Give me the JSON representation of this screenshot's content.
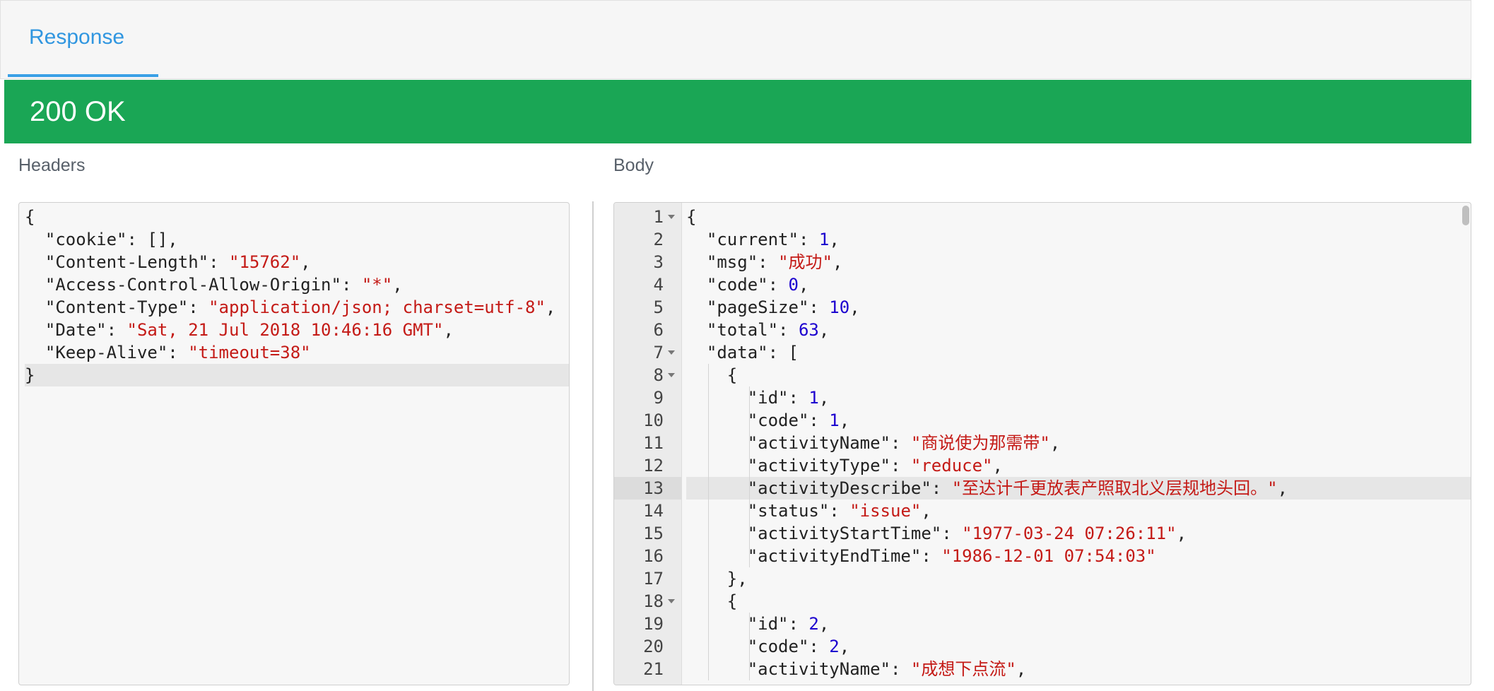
{
  "tabs": [
    {
      "label": "Response",
      "active": true
    }
  ],
  "status": {
    "text": "200 OK",
    "color": "#1aa655"
  },
  "headers_panel": {
    "title": "Headers",
    "lines": [
      [
        {
          "t": "p",
          "v": "{"
        }
      ],
      [
        {
          "t": "k",
          "v": "  \"cookie\""
        },
        {
          "t": "p",
          "v": ": [],"
        }
      ],
      [
        {
          "t": "k",
          "v": "  \"Content-Length\""
        },
        {
          "t": "p",
          "v": ": "
        },
        {
          "t": "s",
          "v": "\"15762\""
        },
        {
          "t": "p",
          "v": ","
        }
      ],
      [
        {
          "t": "k",
          "v": "  \"Access-Control-Allow-Origin\""
        },
        {
          "t": "p",
          "v": ": "
        },
        {
          "t": "s",
          "v": "\"*\""
        },
        {
          "t": "p",
          "v": ","
        }
      ],
      [
        {
          "t": "k",
          "v": "  \"Content-Type\""
        },
        {
          "t": "p",
          "v": ": "
        },
        {
          "t": "s",
          "v": "\"application/json; charset=utf-8\""
        },
        {
          "t": "p",
          "v": ","
        }
      ],
      [
        {
          "t": "k",
          "v": "  \"Date\""
        },
        {
          "t": "p",
          "v": ": "
        },
        {
          "t": "s",
          "v": "\"Sat, 21 Jul 2018 10:46:16 GMT\""
        },
        {
          "t": "p",
          "v": ","
        }
      ],
      [
        {
          "t": "k",
          "v": "  \"Keep-Alive\""
        },
        {
          "t": "p",
          "v": ": "
        },
        {
          "t": "s",
          "v": "\"timeout=38\""
        }
      ],
      [
        {
          "t": "p",
          "v": "}"
        }
      ]
    ],
    "active_line": 8
  },
  "body_panel": {
    "title": "Body",
    "lines": [
      [
        {
          "t": "p",
          "v": "{"
        }
      ],
      [
        {
          "t": "k",
          "v": "  \"current\""
        },
        {
          "t": "p",
          "v": ": "
        },
        {
          "t": "n",
          "v": "1"
        },
        {
          "t": "p",
          "v": ","
        }
      ],
      [
        {
          "t": "k",
          "v": "  \"msg\""
        },
        {
          "t": "p",
          "v": ": "
        },
        {
          "t": "s",
          "v": "\"成功\""
        },
        {
          "t": "p",
          "v": ","
        }
      ],
      [
        {
          "t": "k",
          "v": "  \"code\""
        },
        {
          "t": "p",
          "v": ": "
        },
        {
          "t": "n",
          "v": "0"
        },
        {
          "t": "p",
          "v": ","
        }
      ],
      [
        {
          "t": "k",
          "v": "  \"pageSize\""
        },
        {
          "t": "p",
          "v": ": "
        },
        {
          "t": "n",
          "v": "10"
        },
        {
          "t": "p",
          "v": ","
        }
      ],
      [
        {
          "t": "k",
          "v": "  \"total\""
        },
        {
          "t": "p",
          "v": ": "
        },
        {
          "t": "n",
          "v": "63"
        },
        {
          "t": "p",
          "v": ","
        }
      ],
      [
        {
          "t": "k",
          "v": "  \"data\""
        },
        {
          "t": "p",
          "v": ": ["
        }
      ],
      [
        {
          "t": "p",
          "v": "    {"
        }
      ],
      [
        {
          "t": "k",
          "v": "      \"id\""
        },
        {
          "t": "p",
          "v": ": "
        },
        {
          "t": "n",
          "v": "1"
        },
        {
          "t": "p",
          "v": ","
        }
      ],
      [
        {
          "t": "k",
          "v": "      \"code\""
        },
        {
          "t": "p",
          "v": ": "
        },
        {
          "t": "n",
          "v": "1"
        },
        {
          "t": "p",
          "v": ","
        }
      ],
      [
        {
          "t": "k",
          "v": "      \"activityName\""
        },
        {
          "t": "p",
          "v": ": "
        },
        {
          "t": "s",
          "v": "\"商说使为那需带\""
        },
        {
          "t": "p",
          "v": ","
        }
      ],
      [
        {
          "t": "k",
          "v": "      \"activityType\""
        },
        {
          "t": "p",
          "v": ": "
        },
        {
          "t": "s",
          "v": "\"reduce\""
        },
        {
          "t": "p",
          "v": ","
        }
      ],
      [
        {
          "t": "k",
          "v": "      \"activityDescribe\""
        },
        {
          "t": "p",
          "v": ": "
        },
        {
          "t": "s",
          "v": "\"至达计千更放表产照取北义层规地头回。\""
        },
        {
          "t": "p",
          "v": ","
        }
      ],
      [
        {
          "t": "k",
          "v": "      \"status\""
        },
        {
          "t": "p",
          "v": ": "
        },
        {
          "t": "s",
          "v": "\"issue\""
        },
        {
          "t": "p",
          "v": ","
        }
      ],
      [
        {
          "t": "k",
          "v": "      \"activityStartTime\""
        },
        {
          "t": "p",
          "v": ": "
        },
        {
          "t": "s",
          "v": "\"1977-03-24 07:26:11\""
        },
        {
          "t": "p",
          "v": ","
        }
      ],
      [
        {
          "t": "k",
          "v": "      \"activityEndTime\""
        },
        {
          "t": "p",
          "v": ": "
        },
        {
          "t": "s",
          "v": "\"1986-12-01 07:54:03\""
        }
      ],
      [
        {
          "t": "p",
          "v": "    },"
        }
      ],
      [
        {
          "t": "p",
          "v": "    {"
        }
      ],
      [
        {
          "t": "k",
          "v": "      \"id\""
        },
        {
          "t": "p",
          "v": ": "
        },
        {
          "t": "n",
          "v": "2"
        },
        {
          "t": "p",
          "v": ","
        }
      ],
      [
        {
          "t": "k",
          "v": "      \"code\""
        },
        {
          "t": "p",
          "v": ": "
        },
        {
          "t": "n",
          "v": "2"
        },
        {
          "t": "p",
          "v": ","
        }
      ],
      [
        {
          "t": "k",
          "v": "      \"activityName\""
        },
        {
          "t": "p",
          "v": ": "
        },
        {
          "t": "s",
          "v": "\"成想下点流\""
        },
        {
          "t": "p",
          "v": ","
        }
      ]
    ],
    "line_numbers": [
      "1",
      "2",
      "3",
      "4",
      "5",
      "6",
      "7",
      "8",
      "9",
      "10",
      "11",
      "12",
      "13",
      "14",
      "15",
      "16",
      "17",
      "18",
      "19",
      "20",
      "21"
    ],
    "fold_lines": [
      1,
      7,
      8,
      18
    ],
    "active_line": 13
  },
  "colors": {
    "key": "#222222",
    "string": "#c41a16",
    "number": "#1c00cf",
    "accent": "#3096e0"
  }
}
